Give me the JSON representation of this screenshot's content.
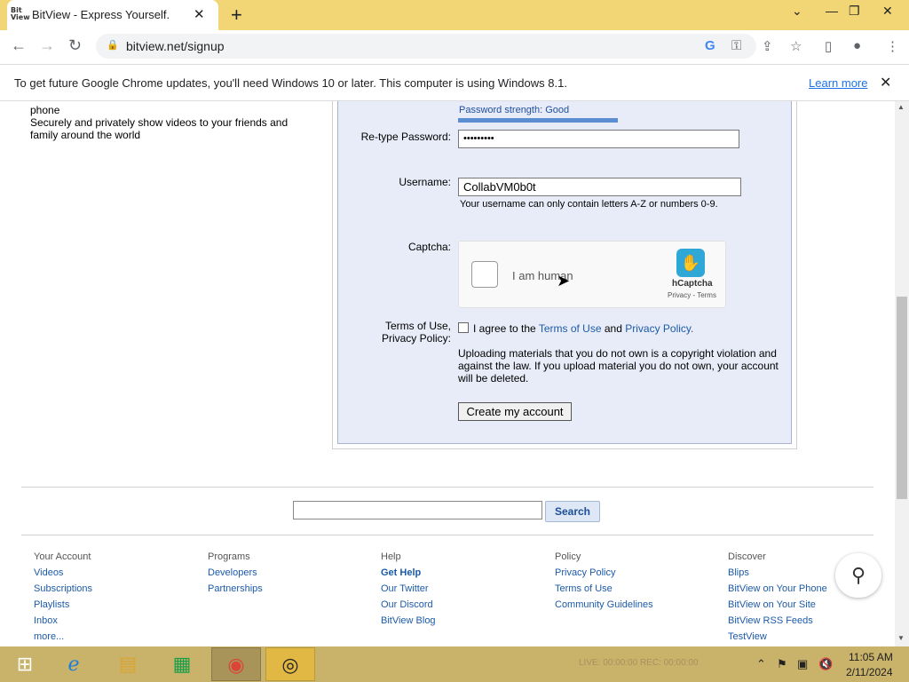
{
  "browser": {
    "tab_title": "BitView - Express Yourself.",
    "favicon_text": "Bit View",
    "url": "bitview.net/signup",
    "infobar_text": "To get future Google Chrome updates, you'll need Windows 10 or later. This computer is using Windows 8.1.",
    "infobar_link": "Learn more"
  },
  "page": {
    "left_text": "phone\nSecurely and privately show videos to your friends and family around the world",
    "form": {
      "password_strength": "Password strength: Good",
      "password_strength_fraction": 0.55,
      "retype_label": "Re-type Password:",
      "retype_value": "•••••••••",
      "username_label": "Username:",
      "username_value": "CollabVM0b0t",
      "username_hint": "Your username can only contain letters A-Z or numbers 0-9.",
      "captcha_label": "Captcha:",
      "captcha_text": "I am human",
      "captcha_brand": "hCaptcha",
      "captcha_links": "Privacy - Terms",
      "tos_label_1": "Terms of Use,",
      "tos_label_2": "Privacy Policy:",
      "tos_agree": "I agree to the",
      "tos_link": "Terms of Use",
      "tos_and": "and",
      "privacy_link": "Privacy Policy.",
      "warning": "Uploading materials that you do not own is a copyright violation and against the law. If you upload material you do not own, your account will be deleted.",
      "create_button": "Create my account"
    },
    "search": {
      "button": "Search"
    },
    "footer": {
      "columns": [
        {
          "heading": "Your Account",
          "links": [
            "Videos",
            "Subscriptions",
            "Playlists",
            "Inbox",
            "more..."
          ]
        },
        {
          "heading": "Programs",
          "links": [
            "Developers",
            "Partnerships"
          ]
        },
        {
          "heading": "Help",
          "links": [
            "Get Help",
            "Our Twitter",
            "Our Discord",
            "BitView Blog"
          ]
        },
        {
          "heading": "Policy",
          "links": [
            "Privacy Policy",
            "Terms of Use",
            "Community Guidelines"
          ]
        },
        {
          "heading": "Discover",
          "links": [
            "Blips",
            "BitView on Your Phone",
            "BitView on Your Site",
            "BitView RSS Feeds",
            "TestView"
          ]
        }
      ]
    }
  },
  "taskbar": {
    "status_text": "LIVE: 00:00:00    REC: 00:00:00",
    "time": "11:05 AM",
    "date": "2/11/2024"
  }
}
